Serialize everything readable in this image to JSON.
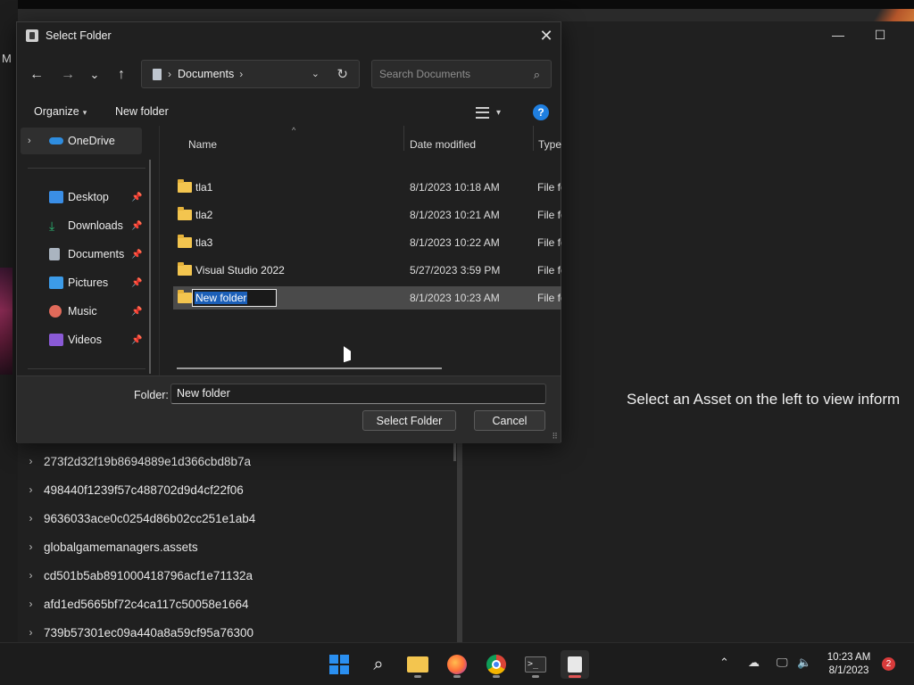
{
  "background_app": {
    "side_letter": "M",
    "placeholder": "Select an Asset on the left to view inform",
    "window_controls": {
      "minimize": "—",
      "maximize": "☐"
    },
    "assets": [
      "273f2d32f19b8694889e1d366cbd8b7a",
      "498440f1239f57c488702d9d4cf22f06",
      "9636033ace0c0254d86b02cc251e1ab4",
      "globalgamemanagers.assets",
      "cd501b5ab891000418796acf1e71132a",
      "afd1ed5665bf72c4ca117c50058e1664",
      "739b57301ec09a440a8a59cf95a76300"
    ]
  },
  "dialog": {
    "title": "Select Folder",
    "close_glyph": "✕",
    "nav": {
      "back": "←",
      "forward": "→",
      "recent": "⌄",
      "up": "↑"
    },
    "address": {
      "separator": "›",
      "crumb": "Documents",
      "dropdown": "⌄",
      "refresh": "↻"
    },
    "search": {
      "placeholder": "Search Documents",
      "icon": "⌕"
    },
    "commands": {
      "organize": "Organize",
      "organize_caret": "▾",
      "new_folder": "New folder",
      "view_caret": "▾",
      "help": "?"
    },
    "nav_pane": {
      "onedrive": "OneDrive",
      "items": [
        {
          "label": "Desktop",
          "icon": "desktop-icon",
          "color": "#3a8ee6"
        },
        {
          "label": "Downloads",
          "icon": "download-icon",
          "color": "#2bb673"
        },
        {
          "label": "Documents",
          "icon": "document-icon",
          "color": "#aab4c0"
        },
        {
          "label": "Pictures",
          "icon": "pictures-icon",
          "color": "#3c9be8"
        },
        {
          "label": "Music",
          "icon": "music-icon",
          "color": "#e06a5a"
        },
        {
          "label": "Videos",
          "icon": "videos-icon",
          "color": "#8a5ad6"
        }
      ],
      "pin_glyph": "📌"
    },
    "columns": {
      "name": "Name",
      "date": "Date modified",
      "type": "Type"
    },
    "files": [
      {
        "name": "tla1",
        "date": "8/1/2023 10:18 AM",
        "type": "File fo"
      },
      {
        "name": "tla2",
        "date": "8/1/2023 10:21 AM",
        "type": "File fo"
      },
      {
        "name": "tla3",
        "date": "8/1/2023 10:22 AM",
        "type": "File fo"
      },
      {
        "name": "Visual Studio 2022",
        "date": "5/27/2023 3:59 PM",
        "type": "File fo"
      },
      {
        "name": "New folder",
        "date": "8/1/2023 10:23 AM",
        "type": "File fo",
        "renaming": true
      }
    ],
    "footer": {
      "folder_label": "Folder:",
      "folder_value": "New folder",
      "select_button": "Select Folder",
      "cancel_button": "Cancel"
    }
  },
  "taskbar": {
    "clock_time": "10:23 AM",
    "clock_date": "8/1/2023",
    "notification_count": "2",
    "tray_chevron": "⌃",
    "accent": "#2a8ff0"
  }
}
